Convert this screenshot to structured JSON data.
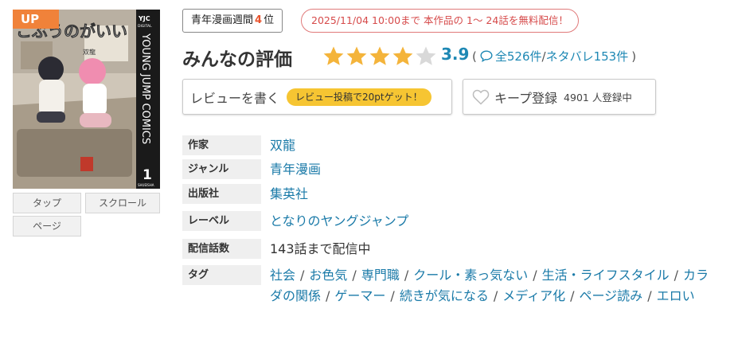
{
  "cover": {
    "badge": "UP",
    "publisher_mark": "YJC",
    "publisher_sub": "DIGITAL",
    "series_label": "YOUNG JUMP COMICS",
    "volume": "1",
    "imprint": "SHUEISHA",
    "author_small": "双龍"
  },
  "view_buttons": [
    "タップ",
    "スクロール",
    "ページ"
  ],
  "rank": {
    "prefix": "青年漫画週間",
    "number": "4",
    "suffix": "位"
  },
  "free_notice": "2025/11/04 10:00まで 本作品の 1～ 24話を無料配信！",
  "rating": {
    "title": "みんなの評価",
    "stars": 3.9,
    "score": "3.9",
    "open_paren": "(",
    "total": "全526件",
    "slash": "/",
    "spoiler": "ネタバレ153件",
    "close_paren": ")"
  },
  "review_button": {
    "label": "レビューを書く",
    "promo": "レビュー投稿で20ptゲット！"
  },
  "keep_button": {
    "label": "キープ登録",
    "count": "4901 人登録中"
  },
  "info": {
    "author_key": "作家",
    "author_val": "双龍",
    "genre_key": "ジャンル",
    "genre_val": "青年漫画",
    "publisher_key": "出版社",
    "publisher_val": "集英社",
    "label_key": "レーベル",
    "label_val": "となりのヤングジャンプ",
    "episodes_key": "配信話数",
    "episodes_val": "143話まで配信中",
    "tags_key": "タグ",
    "tags": [
      "社会",
      "お色気",
      "専門職",
      "クール・素っ気ない",
      "生活・ライフスタイル",
      "カラダの関係",
      "ゲーマー",
      "続きが気になる",
      "メディア化",
      "ページ読み",
      "エロい"
    ]
  },
  "colors": {
    "accent_orange": "#f0823a",
    "rank_red": "#e8542e",
    "free_red": "#d64a4a",
    "star_gold": "#f4b43b",
    "star_empty": "#d9d9d9",
    "link_blue": "#1a7aa8",
    "score_blue": "#1e88b4",
    "promo_yellow": "#f6c532"
  },
  "icons": {
    "star": "star-icon",
    "comment": "speech-bubble-icon",
    "heart": "heart-outline-icon"
  }
}
